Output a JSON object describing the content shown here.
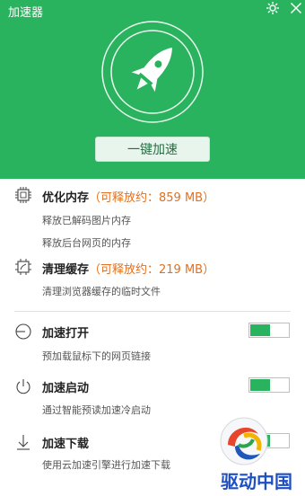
{
  "window": {
    "title": "加速器"
  },
  "header": {
    "boost_button": "一键加速"
  },
  "memory": {
    "title": "优化内存",
    "extra": "（可释放约：859 MB）",
    "lines": [
      "释放已解码图片内存",
      "释放后台网页的内存"
    ]
  },
  "cache": {
    "title": "清理缓存",
    "extra": "（可释放约：219 MB）",
    "lines": [
      "清理浏览器缓存的临时文件"
    ]
  },
  "toggles": [
    {
      "title": "加速打开",
      "desc": "预加载鼠标下的网页链接",
      "on": true
    },
    {
      "title": "加速启动",
      "desc": "通过智能预读加速冷启动",
      "on": true
    },
    {
      "title": "加速下载",
      "desc": "使用云加速引擎进行加速下载",
      "on": true
    }
  ],
  "watermark": {
    "text": "驱动中国"
  },
  "colors": {
    "accent": "#2ab35e",
    "highlight": "#e2701f"
  },
  "icons": [
    "gear-icon",
    "close-icon",
    "rocket-icon",
    "chip-icon",
    "cleanup-icon",
    "open-icon",
    "power-icon",
    "download-icon"
  ]
}
